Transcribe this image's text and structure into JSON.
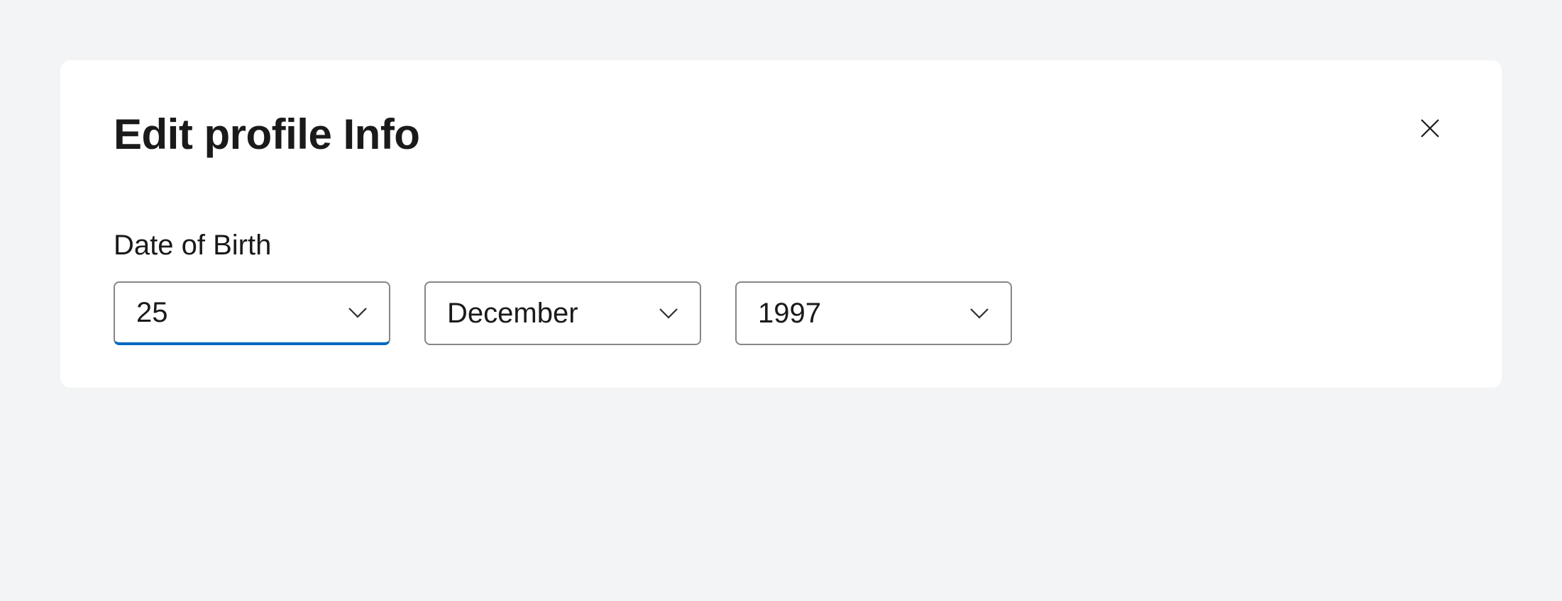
{
  "dialog": {
    "title": "Edit profile Info",
    "field_label": "Date of Birth",
    "day": {
      "value": "25"
    },
    "month": {
      "value": "December"
    },
    "year": {
      "value": "1997"
    }
  }
}
